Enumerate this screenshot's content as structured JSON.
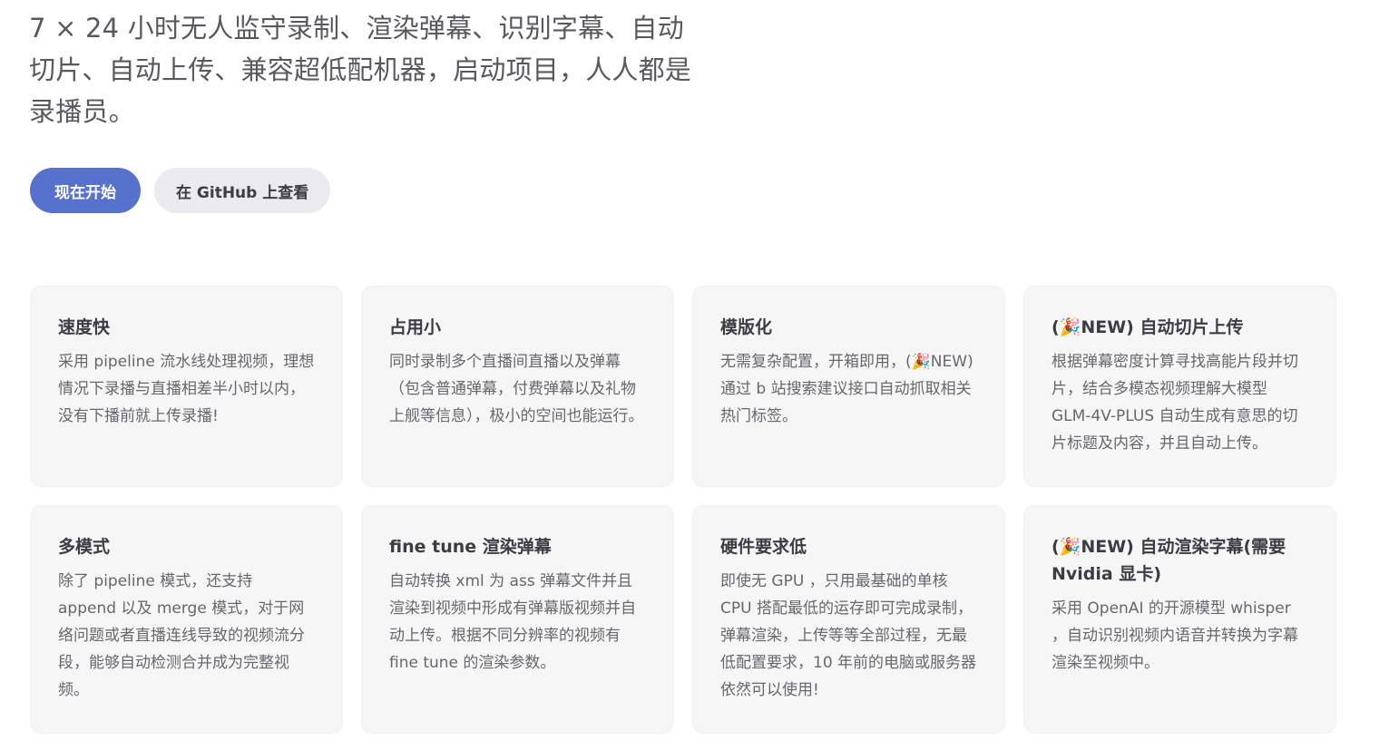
{
  "hero": {
    "tagline": "7 × 24 小时无人监守录制、渲染弹幕、识别字幕、自动切片、自动上传、兼容超低配机器，启动项目，人人都是录播员。",
    "actions": {
      "primary_label": "现在开始",
      "secondary_label": "在 GitHub 上查看"
    }
  },
  "features": [
    {
      "title": "速度快",
      "desc": "采用 pipeline 流水线处理视频，理想情况下录播与直播相差半小时以内，没有下播前就上传录播!"
    },
    {
      "title": "占用小",
      "desc": "同时录制多个直播间直播以及弹幕（包含普通弹幕，付费弹幕以及礼物上舰等信息），极小的空间也能运行。"
    },
    {
      "title": "模版化",
      "desc": "无需复杂配置，开箱即用，(🎉NEW) 通过 b 站搜索建议接口自动抓取相关热门标签。"
    },
    {
      "title": "(🎉NEW) 自动切片上传",
      "desc": "根据弹幕密度计算寻找高能片段并切片，结合多模态视频理解大模型 GLM-4V-PLUS 自动生成有意思的切片标题及内容，并且自动上传。"
    },
    {
      "title": "多模式",
      "desc": "除了 pipeline 模式，还支持 append 以及 merge 模式，对于网络问题或者直播连线导致的视频流分段，能够自动检测合并成为完整视频。"
    },
    {
      "title": "fine tune 渲染弹幕",
      "desc": "自动转换 xml 为 ass 弹幕文件并且渲染到视频中形成有弹幕版视频并自动上传。根据不同分辨率的视频有 fine tune 的渲染参数。"
    },
    {
      "title": "硬件要求低",
      "desc": "即使无 GPU ，只用最基础的单核 CPU 搭配最低的运存即可完成录制，弹幕渲染，上传等等全部过程，无最低配置要求，10 年前的电脑或服务器依然可以使用!"
    },
    {
      "title": "(🎉NEW) 自动渲染字幕(需要 Nvidia 显卡)",
      "desc": "采用 OpenAI 的开源模型 whisper ，自动识别视频内语音并转换为字幕渲染至视频中。"
    }
  ]
}
